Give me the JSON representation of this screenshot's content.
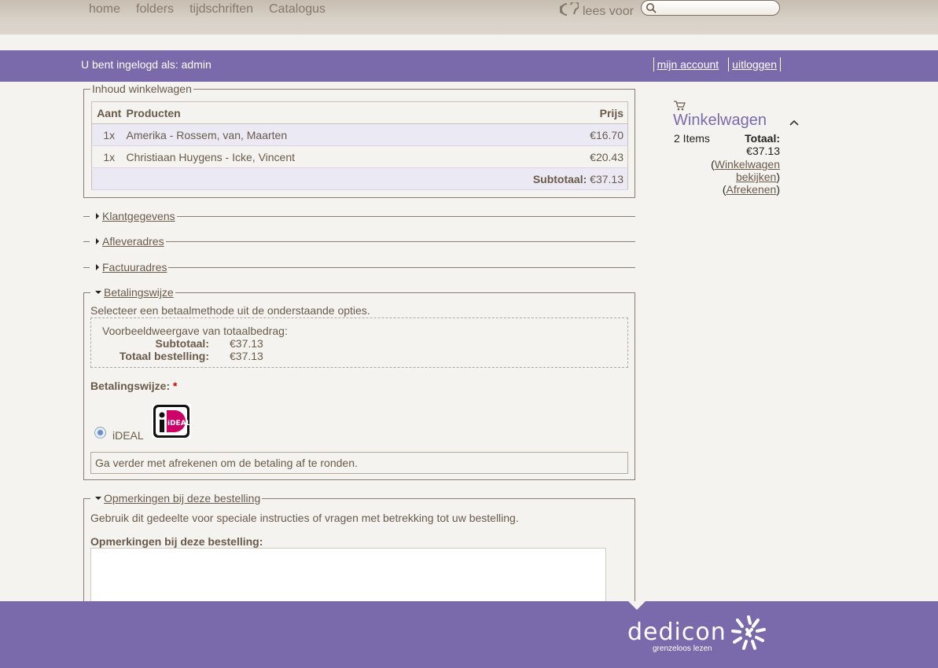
{
  "topnav": {
    "items": [
      "home",
      "folders",
      "tijdschriften",
      "Catalogus"
    ],
    "listen_label": "lees voor",
    "search_placeholder": ""
  },
  "userbar": {
    "logged_in_text": "U bent ingelogd als: admin",
    "account_link": "mijn account",
    "logout_link": "uitloggen"
  },
  "cart": {
    "legend": "Inhoud winkelwagen",
    "headers": [
      "Aant",
      "Producten",
      "Prijs"
    ],
    "rows": [
      {
        "qty": "1x",
        "product": "Amerika - Rossem, van, Maarten",
        "price": "€16.70"
      },
      {
        "qty": "1x",
        "product": "Christiaan Huygens - Icke, Vincent",
        "price": "€20.43"
      }
    ],
    "subtotal_label": "Subtotaal:",
    "subtotal_value": "€37.13"
  },
  "sections": {
    "klant": "Klantgegevens",
    "aflever": "Afleveradres",
    "factuur": "Factuuradres"
  },
  "payment": {
    "legend": "Betalingswijze",
    "intro": "Selecteer een betaalmethode uit de onderstaande opties.",
    "preview_title": "Voorbeeldweergave van totaalbedrag:",
    "subtotal_label": "Subtotaal:",
    "subtotal_value": "€37.13",
    "total_label": "Totaal bestelling:",
    "total_value": "€37.13",
    "method_label": "Betalingswijze:",
    "required_mark": "*",
    "ideal_label": "iDEAL",
    "ideal_logo_text": "iDEAL",
    "continue_text": "Ga verder met afrekenen om de betaling af te ronden."
  },
  "remarks": {
    "legend": "Opmerkingen bij deze bestelling",
    "intro": "Gebruik dit gedeelte voor speciale instructies of vragen met betrekking tot uw bestelling.",
    "field_label": "Opmerkingen bij deze bestelling:",
    "value": ""
  },
  "sidecart": {
    "title": "Winkelwagen",
    "items": "2 Items",
    "total_label": "Totaal:",
    "total_value": "€37.13",
    "view_link": "Winkelwagen bekijken",
    "checkout_link": "Afrekenen"
  },
  "footer": {
    "brand": "dedicon",
    "tagline": "grenzeloos lezen"
  },
  "colors": {
    "purple": "#7b6aab",
    "text": "#6a5a4a",
    "background": "#f4f3ef"
  }
}
